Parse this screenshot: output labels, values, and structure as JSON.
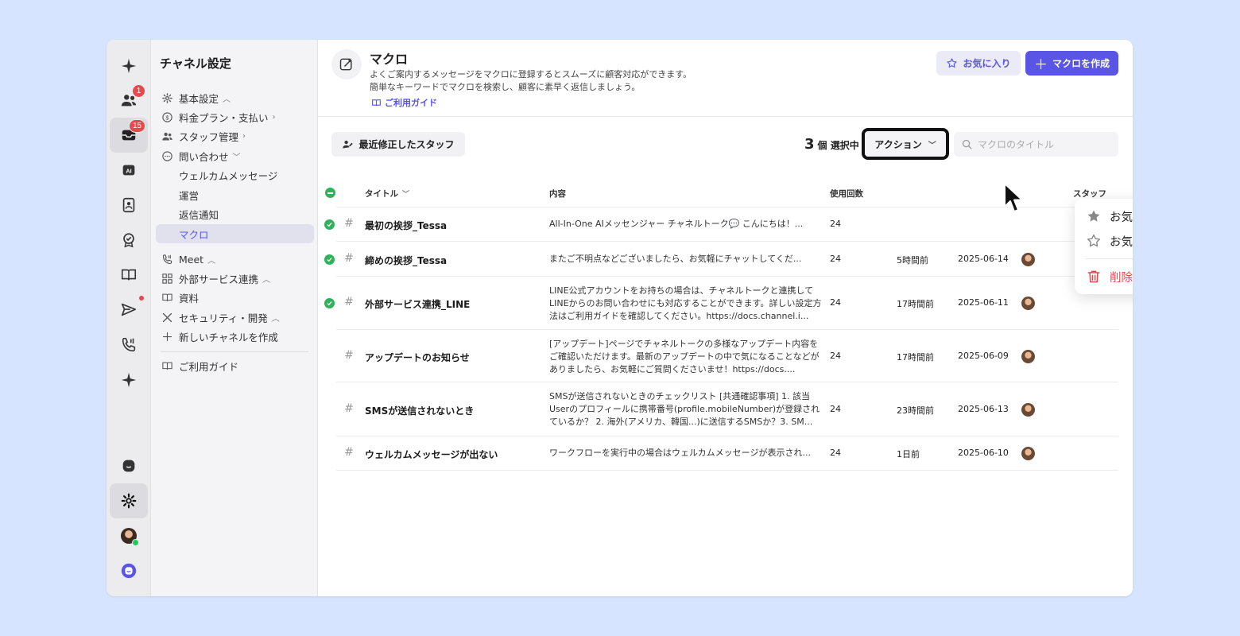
{
  "rail": {
    "badges": {
      "contacts": "1",
      "inbox": "15"
    }
  },
  "sidebar": {
    "title": "チャネル設定",
    "items": [
      {
        "label": "基本設定",
        "icon": "gear-icon",
        "chevron": "up"
      },
      {
        "label": "料金プラン・支払い",
        "icon": "dollar-icon",
        "chevron": "right"
      },
      {
        "label": "スタッフ管理",
        "icon": "users-icon",
        "chevron": "right"
      },
      {
        "label": "問い合わせ",
        "icon": "chat-icon",
        "chevron": "down"
      },
      {
        "label": "ウェルカムメッセージ"
      },
      {
        "label": "運営"
      },
      {
        "label": "返信通知"
      },
      {
        "label": "マクロ",
        "active": true
      },
      {
        "label": "Meet",
        "icon": "phone-icon",
        "chevron": "up"
      },
      {
        "label": "外部サービス連携",
        "icon": "grid-icon",
        "chevron": "up"
      },
      {
        "label": "資料",
        "icon": "book-icon"
      },
      {
        "label": "セキュリティ・開発",
        "icon": "tools-icon",
        "chevron": "up"
      },
      {
        "label": "新しいチャネルを作成",
        "icon": "plus-icon"
      },
      {
        "label": "ご利用ガイド",
        "icon": "book-icon"
      }
    ]
  },
  "header": {
    "title": "マクロ",
    "description_line1": "よくご案内するメッセージをマクロに登録するとスムーズに顧客対応ができます。",
    "description_line2": "簡単なキーワードでマクロを検索し、顧客に素早く返信しましょう。",
    "guide_link": "ご利用ガイド",
    "favorite_button": "お気に入り",
    "create_button": "マクロを作成"
  },
  "toolbar": {
    "recent_staff_button": "最近修正したスタッフ",
    "selected_count": "3",
    "selected_suffix": "個 選択中",
    "action_button": "アクション",
    "search_placeholder": "マクロのタイトル"
  },
  "table": {
    "columns": {
      "title": "タイトル",
      "content": "内容",
      "uses": "使用回数",
      "staff": "スタッフ"
    },
    "rows": [
      {
        "checked": true,
        "title": "最初の挨拶_Tessa",
        "content": "All-In-One AIメッセンジャー チャネルトーク💬 こんにちは！...",
        "uses": "24",
        "modified": "",
        "date": ""
      },
      {
        "checked": true,
        "title": "締めの挨拶_Tessa",
        "content": "またご不明点などございましたら、お気軽にチャットしてくだ...",
        "uses": "24",
        "modified": "5時間前",
        "date": "2025-06-14"
      },
      {
        "checked": true,
        "title": "外部サービス連携_LINE",
        "content": "LINE公式アカウントをお持ちの場合は、チャネルトークと連携してLINEからのお問い合わせにも対応することができます。詳しい設定方法はご利用ガイドを確認してください。https://docs.channel.i...",
        "uses": "24",
        "modified": "17時間前",
        "date": "2025-06-11"
      },
      {
        "checked": false,
        "title": "アップデートのお知らせ",
        "content": "[アップデート]ページでチャネルトークの多様なアップデート内容をご確認いただけます。最新のアップデートの中で気になることなどがありましたら、お気軽にご質問くださいませ！https://docs....",
        "uses": "24",
        "modified": "17時間前",
        "date": "2025-06-09"
      },
      {
        "checked": false,
        "title": "SMSが送信されないとき",
        "content": "SMSが送信されないときのチェックリスト [共通確認事項] 1. 該当Userのプロフィールに携帯番号(profile.mobileNumber)が登録されているか？ 2. 海外(アメリカ、韓国...)に送信するSMSか？3. SM...",
        "uses": "24",
        "modified": "23時間前",
        "date": "2025-06-13"
      },
      {
        "checked": false,
        "title": "ウェルカムメッセージが出ない",
        "content": "ワークフローを実行中の場合はウェルカムメッセージが表示され...",
        "uses": "24",
        "modified": "1日前",
        "date": "2025-06-10"
      }
    ]
  },
  "dropdown": {
    "set_favorite": "お気に入りに設定",
    "unset_favorite": "お気に入りを解除",
    "delete": "削除"
  },
  "colors": {
    "accent": "#5b55e6",
    "danger": "#e5484d",
    "success": "#2fb25a"
  }
}
